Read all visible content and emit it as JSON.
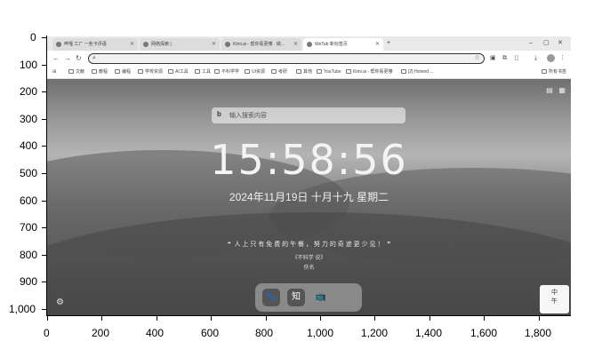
{
  "axes": {
    "y_ticks": [
      "0",
      "100",
      "200",
      "300",
      "400",
      "500",
      "600",
      "700",
      "800",
      "900",
      "1,000"
    ],
    "x_ticks": [
      "0",
      "200",
      "400",
      "600",
      "800",
      "1,000",
      "1,200",
      "1,400",
      "1,600",
      "1,800"
    ]
  },
  "tabs": [
    {
      "label": "哔哩 工厂 一些卡评语"
    },
    {
      "label": "网络探索 | "
    },
    {
      "label": "Kimi.ai - 帮你看更懂 · 做... "
    },
    {
      "label": "WeTab 新标签页",
      "active": true
    }
  ],
  "window_controls": {
    "minimize": "–",
    "maximize": "▢",
    "close": "✕",
    "new_tab": "+"
  },
  "toolbar": {
    "back": "←",
    "forward": "→",
    "reload": "↻",
    "omnibox_value": ""
  },
  "bookmarks": [
    {
      "label": "文献"
    },
    {
      "label": "教程"
    },
    {
      "label": "编程"
    },
    {
      "label": "学校资源"
    },
    {
      "label": "AI工具"
    },
    {
      "label": "工具"
    },
    {
      "label": "不科学学"
    },
    {
      "label": "UI资源"
    },
    {
      "label": "考研"
    },
    {
      "label": "其他"
    },
    {
      "label": "YouTube"
    },
    {
      "label": "Kimi.ai - 帮你看更懂"
    },
    {
      "label": "[2] Hotend ..."
    }
  ],
  "bookmarks_right": "所有书签",
  "ntp": {
    "search_placeholder": "输入搜索内容",
    "clock": "15:58:56",
    "date": "2024年11月19日  十月十九  星期二",
    "quote": "人 上 只 有 免 费 的 午 餐 ， 努 力 的 奇 迹 更 少 见 ！",
    "quote_source": "《不科学 说》",
    "quote_author": "佚名",
    "dock_apps": [
      "🐾",
      "知",
      "📺"
    ],
    "widget_text": "中\n午"
  }
}
